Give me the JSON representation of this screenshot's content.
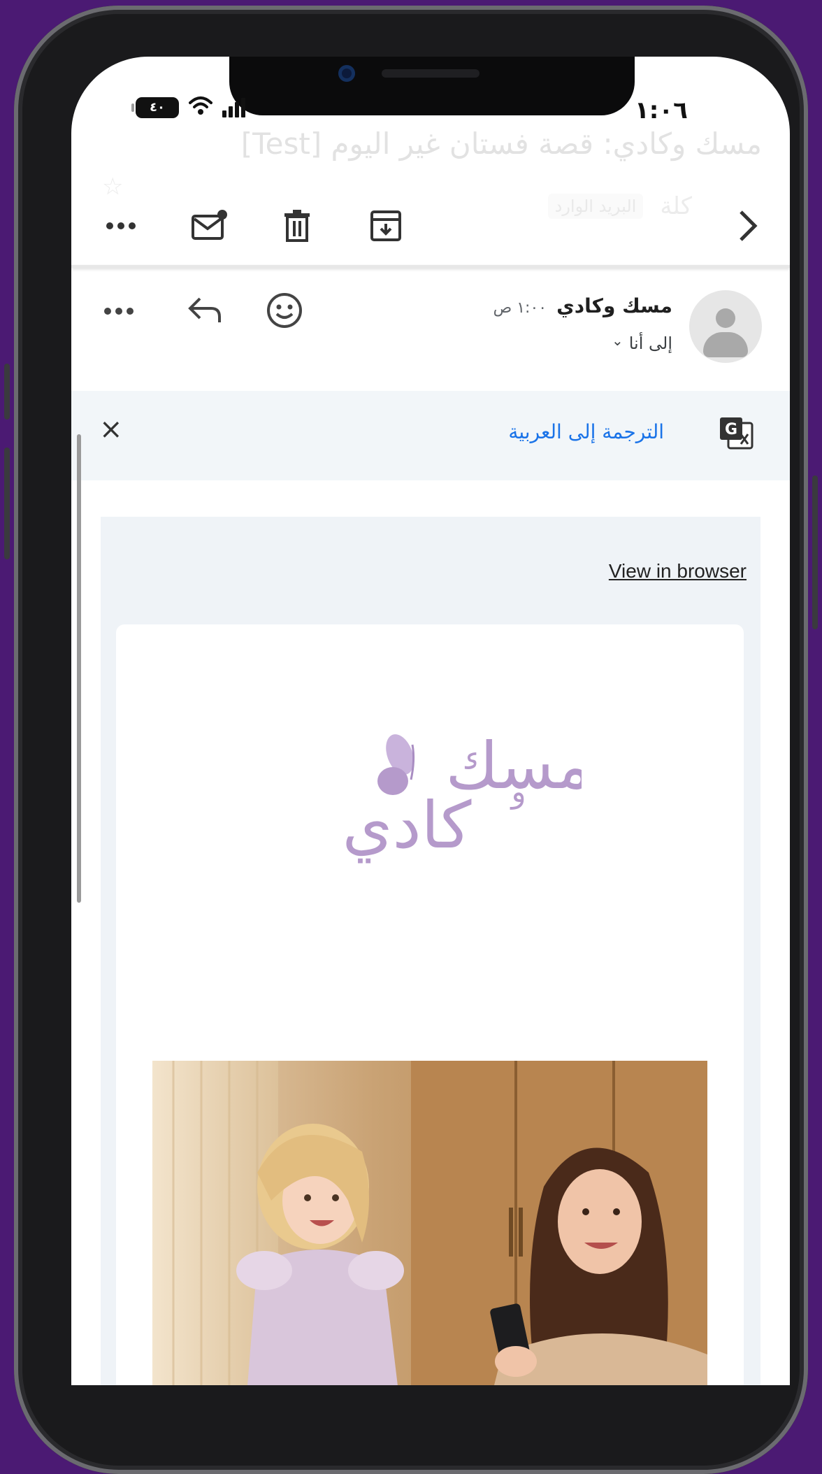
{
  "status_bar": {
    "time": "١:٠٦",
    "battery": "٤٠"
  },
  "email": {
    "subject": "مسك وكادي: قصة فستان غير اليوم [Test]",
    "labels": [
      "كلة",
      "البريد الوارد"
    ],
    "sender_name": "مسك وكادي",
    "sent_time": "١:٠٠ ص",
    "recipient": "إلى أنا",
    "recipient_chevron": "⌄"
  },
  "toolbar": {
    "back_icon": "chevron-right-icon",
    "archive_icon": "archive-icon",
    "delete_icon": "trash-icon",
    "mark_unread_icon": "mark-unread-icon",
    "more_icon": "more-icon"
  },
  "translation": {
    "label": "الترجمة إلى العربية",
    "close": "×"
  },
  "body": {
    "view_in_browser": "View in browser",
    "logo_text_line1": "مسك",
    "logo_text_conj": "و",
    "logo_text_line2": "كادي"
  },
  "colors": {
    "background": "#4b1a73",
    "link_blue": "#1a73e8",
    "logo_purple": "#b59acb"
  }
}
